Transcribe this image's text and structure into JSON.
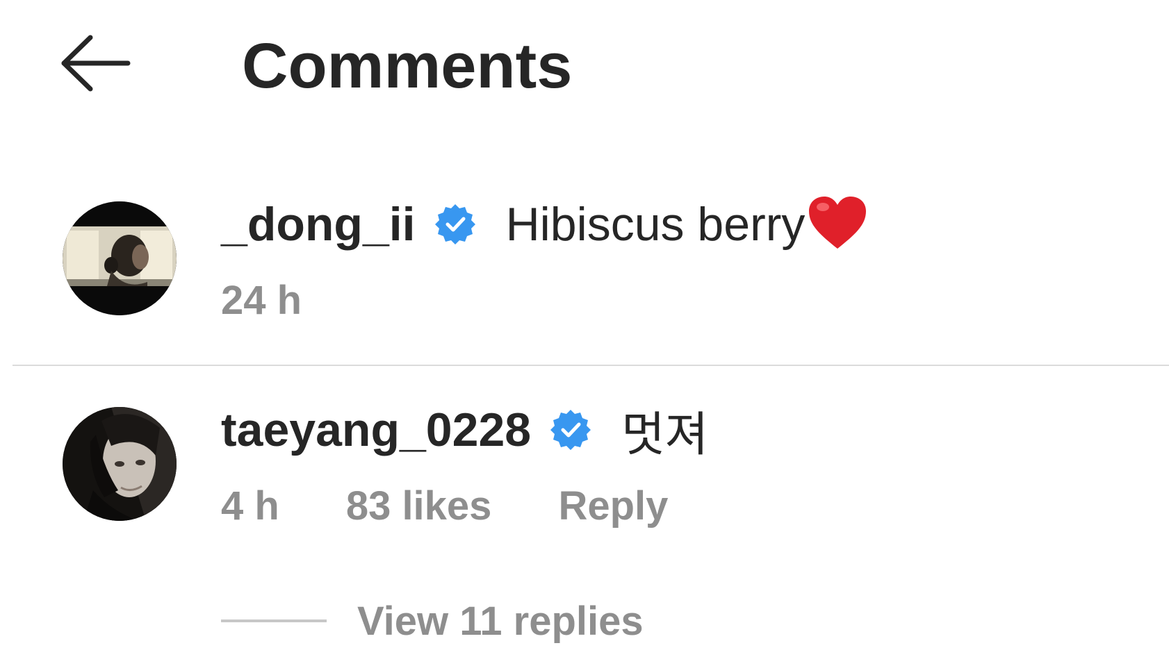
{
  "header": {
    "title": "Comments",
    "back_icon": "arrow-left-icon"
  },
  "comments": [
    {
      "username": "_dong_ii",
      "verified": true,
      "text": "Hibiscus berry",
      "emoji": "red-heart-icon",
      "time": "24 h"
    },
    {
      "username": "taeyang_0228",
      "verified": true,
      "text": "멋져",
      "time": "4 h",
      "likes": "83 likes",
      "reply_label": "Reply",
      "view_replies": "View 11 replies"
    }
  ],
  "colors": {
    "text_primary": "#262626",
    "text_secondary": "#8e8e8e",
    "verified_badge": "#3897f0",
    "divider": "#dbdbdb",
    "heart": "#e0202a"
  }
}
